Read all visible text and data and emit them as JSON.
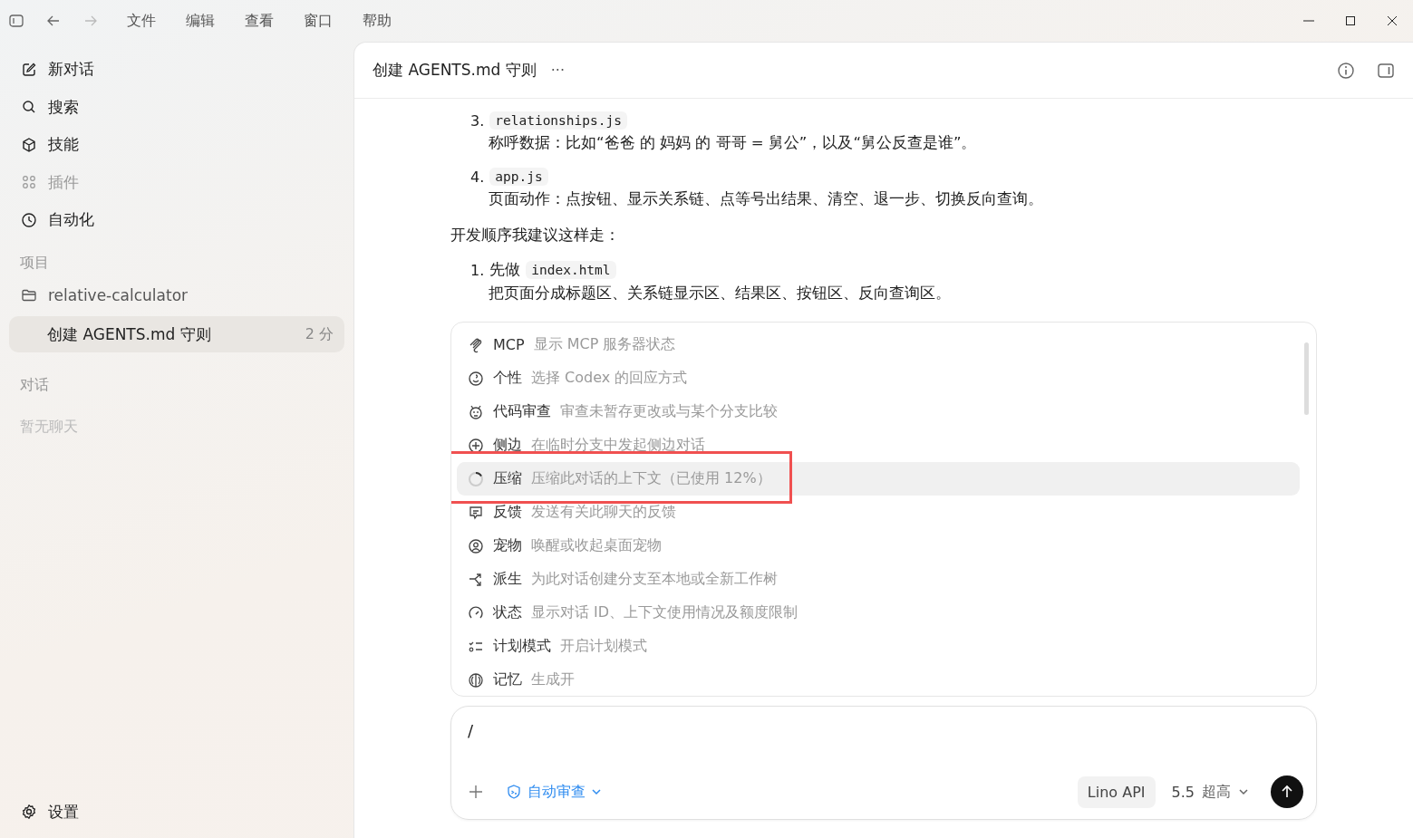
{
  "menu": [
    "文件",
    "编辑",
    "查看",
    "窗口",
    "帮助"
  ],
  "sidebar": {
    "nav": [
      {
        "label": "新对话",
        "disabled": false
      },
      {
        "label": "搜索",
        "disabled": false
      },
      {
        "label": "技能",
        "disabled": false
      },
      {
        "label": "插件",
        "disabled": true
      },
      {
        "label": "自动化",
        "disabled": false
      }
    ],
    "projects_heading": "项目",
    "project": "relative-calculator",
    "threads": [
      {
        "title": "创建 AGENTS.md 守则",
        "time": "2 分",
        "selected": true
      }
    ],
    "chats_heading": "对话",
    "chats_empty": "暂无聊天",
    "settings": "设置"
  },
  "header": {
    "title": "创建 AGENTS.md 守则",
    "more": "···"
  },
  "message": [
    {
      "kind": "step",
      "number": "3.",
      "code": "relationships.js",
      "text": "称呼数据：比如“爸爸 的 妈妈 的 哥哥 = 舅公”，以及“舅公反查是谁”。"
    },
    {
      "kind": "step",
      "number": "4.",
      "code": "app.js",
      "text": "页面动作：点按钮、显示关系链、点等号出结果、清空、退一步、切换反向查询。"
    },
    {
      "kind": "para",
      "text": "开发顺序我建议这样走："
    },
    {
      "kind": "step",
      "number": "1.",
      "lead": "先做",
      "code": "index.html",
      "text": "把页面分成标题区、关系链显示区、结果区、按钮区、反向查询区。"
    }
  ],
  "commands": [
    {
      "name": "MCP",
      "desc": "显示 MCP 服务器状态",
      "selected": false
    },
    {
      "name": "个性",
      "desc": "选择 Codex 的回应方式",
      "selected": false
    },
    {
      "name": "代码审查",
      "desc": "审查未暂存更改或与某个分支比较",
      "selected": false
    },
    {
      "name": "侧边",
      "desc": "在临时分支中发起侧边对话",
      "selected": false
    },
    {
      "name": "压缩",
      "desc": "压缩此对话的上下文（已使用 12%）",
      "selected": true
    },
    {
      "name": "反馈",
      "desc": "发送有关此聊天的反馈",
      "selected": false
    },
    {
      "name": "宠物",
      "desc": "唤醒或收起桌面宠物",
      "selected": false
    },
    {
      "name": "派生",
      "desc": "为此对话创建分支至本地或全新工作树",
      "selected": false
    },
    {
      "name": "状态",
      "desc": "显示对话 ID、上下文使用情况及额度限制",
      "selected": false
    },
    {
      "name": "计划模式",
      "desc": "开启计划模式",
      "selected": false
    },
    {
      "name": "记忆",
      "desc": "生成开",
      "selected": false
    }
  ],
  "composer": {
    "value": "/",
    "mode": "自动审查",
    "provider": "Lino API",
    "model": "5.5",
    "effort": "超高"
  }
}
